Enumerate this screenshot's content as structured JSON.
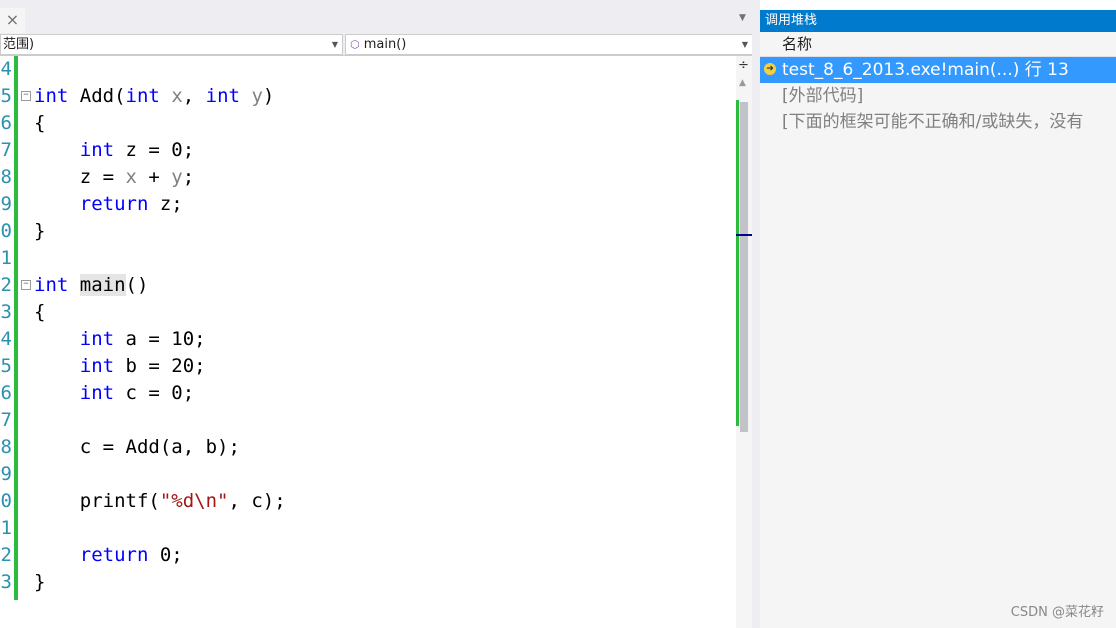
{
  "editor": {
    "tab_close": "×",
    "scope_combo": "范围)",
    "member_combo": "main()",
    "lines": [
      {
        "n": "4",
        "html": ""
      },
      {
        "n": "5",
        "fold": true,
        "html": "<span class=\"kw\">int</span> Add(<span class=\"kw\">int</span> <span class=\"pm\">x</span>, <span class=\"kw\">int</span> <span class=\"pm\">y</span>)"
      },
      {
        "n": "6",
        "html": "{"
      },
      {
        "n": "7",
        "html": "    <span class=\"kw\">int</span> z = 0;"
      },
      {
        "n": "8",
        "html": "    z = <span class=\"pm\">x</span> + <span class=\"pm\">y</span>;"
      },
      {
        "n": "9",
        "html": "    <span class=\"kw\">return</span> z;"
      },
      {
        "n": "0",
        "html": "}"
      },
      {
        "n": "1",
        "html": ""
      },
      {
        "n": "2",
        "fold": true,
        "html": "<span class=\"kw\">int</span> <span class=\"hl\">main</span>()"
      },
      {
        "n": "3",
        "html": "{"
      },
      {
        "n": "4",
        "html": "    <span class=\"kw\">int</span> a = 10;"
      },
      {
        "n": "5",
        "html": "    <span class=\"kw\">int</span> b = 20;"
      },
      {
        "n": "6",
        "html": "    <span class=\"kw\">int</span> c = 0;"
      },
      {
        "n": "7",
        "html": ""
      },
      {
        "n": "8",
        "html": "    c = Add(a, b);"
      },
      {
        "n": "9",
        "html": ""
      },
      {
        "n": "0",
        "html": "    printf(<span class=\"st\">\"%d\\n\"</span>, c);"
      },
      {
        "n": "1",
        "html": ""
      },
      {
        "n": "2",
        "html": "    <span class=\"kw\">return</span> 0;"
      },
      {
        "n": "3",
        "html": "}"
      }
    ]
  },
  "callstack": {
    "title": "调用堆栈",
    "column": "名称",
    "rows": [
      "test_8_6_2013.exe!main(...) 行 13",
      "[外部代码]",
      "[下面的框架可能不正确和/或缺失，没有"
    ]
  },
  "watermark": "CSDN @菜花籽",
  "colors": {
    "accent": "#007acc",
    "selection": "#3399ff",
    "keyword": "#0000ff",
    "string": "#a31515",
    "change_bar": "#2dbb3d"
  }
}
